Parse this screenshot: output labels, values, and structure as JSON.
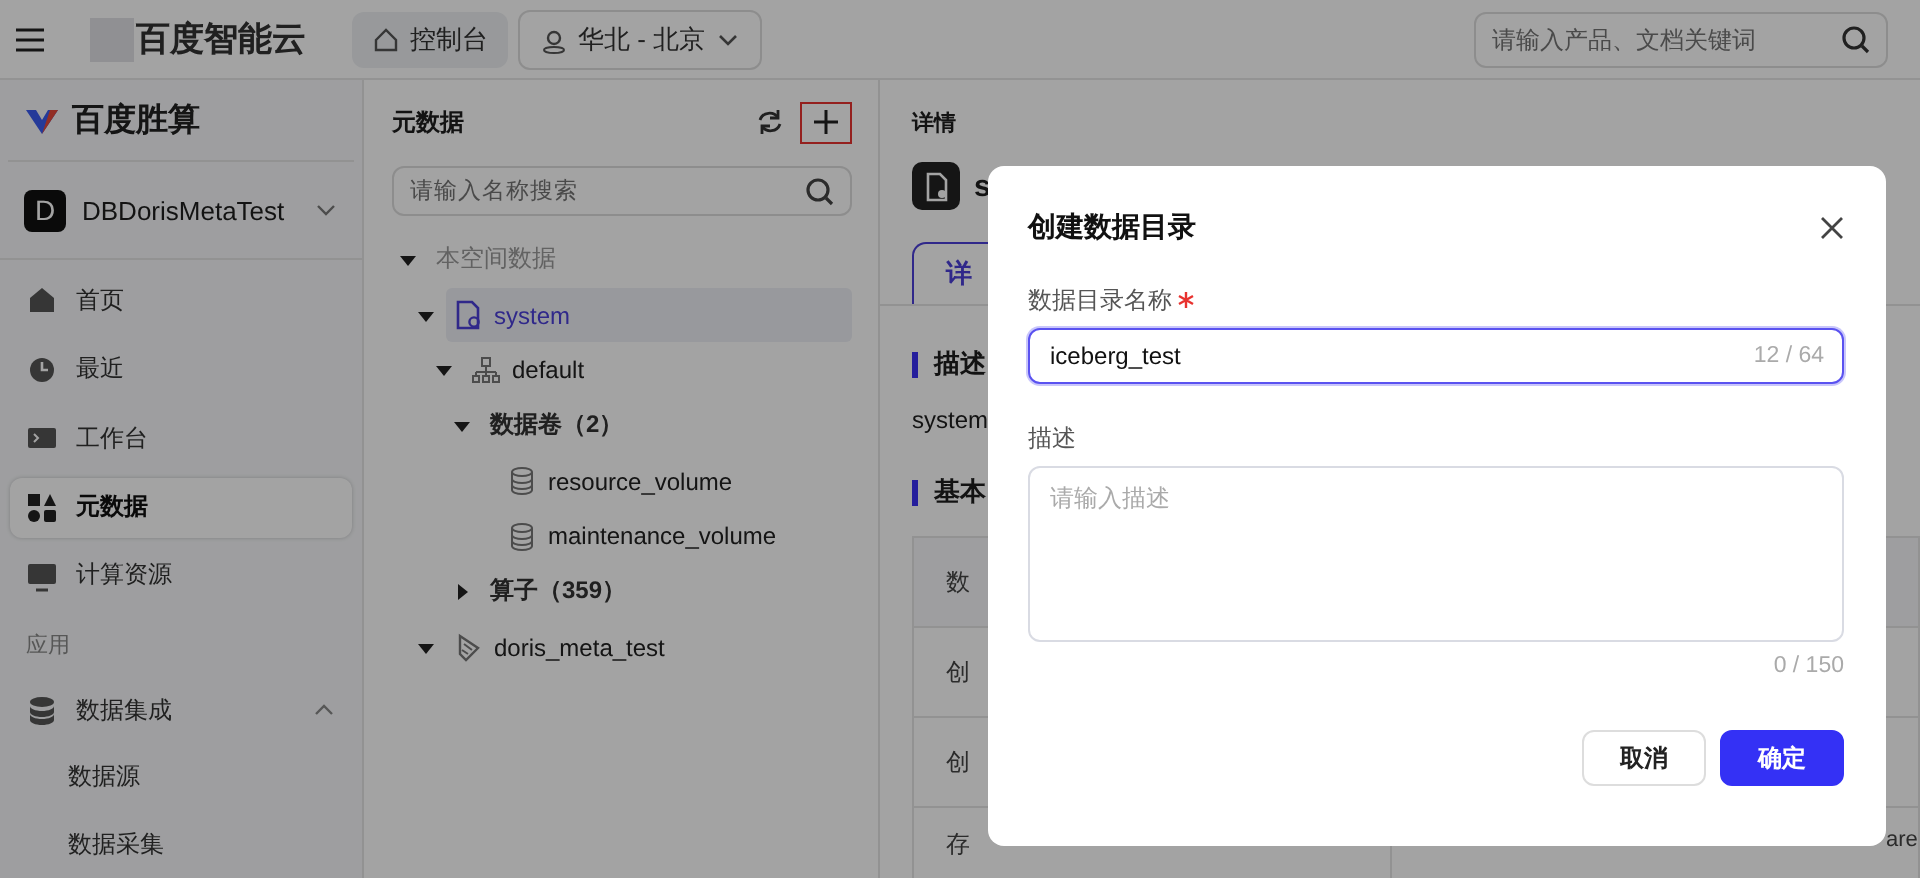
{
  "topbar": {
    "brand": "百度智能云",
    "console": "控制台",
    "region": "华北 - 北京",
    "search": {
      "placeholder": "请输入产品、文档关键词"
    }
  },
  "sidebar": {
    "product": "百度胜算",
    "workspace": {
      "initial": "D",
      "name": "DBDorisMetaTest"
    },
    "items": [
      {
        "kind": "item",
        "label": "首页",
        "selected": false
      },
      {
        "kind": "item",
        "label": "最近",
        "selected": false
      },
      {
        "kind": "item",
        "label": "工作台",
        "selected": false
      },
      {
        "kind": "item",
        "label": "元数据",
        "selected": true
      },
      {
        "kind": "item",
        "label": "计算资源",
        "selected": false
      },
      {
        "kind": "section",
        "label": "应用"
      },
      {
        "kind": "group",
        "label": "数据集成",
        "expanded": true
      },
      {
        "kind": "subitem",
        "label": "数据源",
        "selected": false
      },
      {
        "kind": "subitem",
        "label": "数据采集",
        "selected": false
      }
    ]
  },
  "tree": {
    "title": "元数据",
    "add_highlighted": true,
    "search": {
      "placeholder": "请输入名称搜索"
    },
    "nodes": [
      {
        "label": "本空间数据",
        "kind": "space",
        "expanded": true,
        "children": [
          {
            "label": "system",
            "kind": "catalog",
            "expanded": true,
            "selected": true,
            "children": [
              {
                "label": "default",
                "kind": "schema",
                "expanded": true,
                "selected": false,
                "children": [
                  {
                    "label": "数据卷（2）",
                    "kind": "folder",
                    "expanded": true,
                    "selected": false,
                    "children": [
                      {
                        "label": "resource_volume",
                        "kind": "volume",
                        "selected": false
                      },
                      {
                        "label": "maintenance_volume",
                        "kind": "volume",
                        "selected": false
                      }
                    ]
                  },
                  {
                    "label": "算子（359）",
                    "kind": "folder",
                    "expanded": false,
                    "selected": false
                  }
                ]
              }
            ]
          },
          {
            "label": "doris_meta_test",
            "kind": "external",
            "expanded": true,
            "selected": false
          }
        ]
      }
    ]
  },
  "detail": {
    "heading": "详情",
    "name": "s",
    "tabs": [
      {
        "label": "详",
        "selected": true
      }
    ],
    "description_title": "描述",
    "description": "system",
    "info_title": "基本",
    "rows": [
      {
        "label": "数"
      },
      {
        "label": "创"
      },
      {
        "label": "创"
      },
      {
        "label": "存",
        "value": "are"
      }
    ]
  },
  "dialog": {
    "title": "创建数据目录",
    "fields": [
      {
        "kind": "input",
        "label": "数据目录名称",
        "required": true,
        "value": "iceberg_test",
        "focused": true,
        "count": "12 / 64"
      },
      {
        "kind": "textarea",
        "label": "描述",
        "required": false,
        "placeholder": "请输入描述",
        "focused": false,
        "count": "0 / 150"
      }
    ],
    "buttons": [
      {
        "label": "取消",
        "primary": false
      },
      {
        "label": "确定",
        "primary": true
      }
    ]
  }
}
